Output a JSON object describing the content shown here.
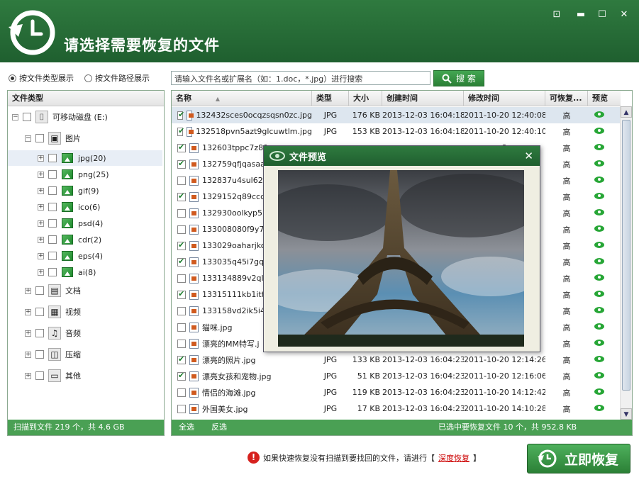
{
  "app": {
    "title": "请选择需要恢复的文件",
    "accent_color": "#2b7d3a",
    "window_buttons": [
      "minimize-to-tray",
      "minimize",
      "maximize",
      "close"
    ]
  },
  "view_mode": {
    "option1": "按文件类型展示",
    "option2": "按文件路径展示",
    "selected": "option1"
  },
  "search": {
    "value": "请输入文件名或扩展名（如：1.doc，*.jpg）进行搜索",
    "button": "搜 索"
  },
  "tree": {
    "header": "文件类型",
    "root": "可移动磁盘 (E:)",
    "pictures": "图片",
    "sub": [
      {
        "label": "jpg(20)",
        "selected": true
      },
      {
        "label": "png(25)"
      },
      {
        "label": "gif(9)"
      },
      {
        "label": "ico(6)"
      },
      {
        "label": "psd(4)"
      },
      {
        "label": "cdr(2)"
      },
      {
        "label": "eps(4)"
      },
      {
        "label": "ai(8)"
      }
    ],
    "others": [
      {
        "label": "文档",
        "icon": "document-icon"
      },
      {
        "label": "视频",
        "icon": "film-icon"
      },
      {
        "label": "音频",
        "icon": "music-icon"
      },
      {
        "label": "压缩",
        "icon": "archive-icon"
      },
      {
        "label": "其他",
        "icon": "window-icon"
      }
    ],
    "footer": "扫描到文件 219 个，共 4.6 GB"
  },
  "table": {
    "columns": {
      "name": "名称",
      "type": "类型",
      "size": "大小",
      "created": "创建时间",
      "modified": "修改时间",
      "recoverable": "可恢复...",
      "preview": "预览"
    },
    "rows": [
      {
        "name": "132432sces0ocqzsqsn0zc.jpg",
        "type": "JPG",
        "size": "176 KB",
        "created": "2013-12-03 16:04:18",
        "modified": "2011-10-20 12:40:08",
        "rec": "高",
        "checked": true,
        "selected": true
      },
      {
        "name": "132518pvn5azt9glcuwtlm.jpg",
        "type": "JPG",
        "size": "153 KB",
        "created": "2013-12-03 16:04:18",
        "modified": "2011-10-20 12:40:10",
        "rec": "高",
        "checked": true
      },
      {
        "name": "132603tppc7z89z",
        "type": "",
        "size": "",
        "created": "",
        "modified": "2",
        "rec": "高",
        "checked": true
      },
      {
        "name": "132759qfjqasaa7",
        "type": "",
        "size": "",
        "created": "",
        "modified": "",
        "rec": "高",
        "checked": true
      },
      {
        "name": "132837u4sul62f8",
        "type": "",
        "size": "",
        "created": "",
        "modified": "",
        "rec": "高",
        "checked": false
      },
      {
        "name": "1329152q89ccq6",
        "type": "",
        "size": "",
        "created": "",
        "modified": "",
        "rec": "高",
        "checked": true
      },
      {
        "name": "132930oolkyp5hc",
        "type": "",
        "size": "",
        "created": "",
        "modified": "",
        "rec": "高",
        "checked": false
      },
      {
        "name": "133008080f9y7ih",
        "type": "",
        "size": "",
        "created": "",
        "modified": "",
        "rec": "高",
        "checked": false
      },
      {
        "name": "133029oaharjkoo",
        "type": "",
        "size": "",
        "created": "",
        "modified": "",
        "rec": "高",
        "checked": true
      },
      {
        "name": "133035q45i7gq8",
        "type": "",
        "size": "",
        "created": "",
        "modified": "",
        "rec": "高",
        "checked": true
      },
      {
        "name": "133134889v2ql9l3",
        "type": "",
        "size": "",
        "created": "",
        "modified": "",
        "rec": "高",
        "checked": false
      },
      {
        "name": "13315111kb1itt1l",
        "type": "",
        "size": "",
        "created": "",
        "modified": "",
        "rec": "高",
        "checked": true
      },
      {
        "name": "133158vd2ik5i4k",
        "type": "",
        "size": "",
        "created": "",
        "modified": "",
        "rec": "高",
        "checked": false
      },
      {
        "name": "猫咪.jpg",
        "type": "",
        "size": "",
        "created": "",
        "modified": "",
        "rec": "高",
        "checked": false
      },
      {
        "name": "漂亮的MM特写.j",
        "type": "",
        "size": "",
        "created": "",
        "modified": "",
        "rec": "高",
        "checked": false
      },
      {
        "name": "漂亮的照片.jpg",
        "type": "JPG",
        "size": "133 KB",
        "created": "2013-12-03 16:04:23",
        "modified": "2011-10-20 12:14:26",
        "rec": "高",
        "checked": true
      },
      {
        "name": "漂亮女孩和宠物.jpg",
        "type": "JPG",
        "size": "51 KB",
        "created": "2013-12-03 16:04:23",
        "modified": "2011-10-20 12:16:06",
        "rec": "高",
        "checked": true
      },
      {
        "name": "情侣的海滩.jpg",
        "type": "JPG",
        "size": "119 KB",
        "created": "2013-12-03 16:04:23",
        "modified": "2011-10-20 14:12:42",
        "rec": "高",
        "checked": false
      },
      {
        "name": "外国美女.jpg",
        "type": "JPG",
        "size": "17 KB",
        "created": "2013-12-03 16:04:23",
        "modified": "2011-10-20 14:10:28",
        "rec": "高",
        "checked": false
      }
    ],
    "footer": {
      "select_all": "全选",
      "invert": "反选",
      "status": "已选中要恢复文件 10 个，共 952.8 KB"
    }
  },
  "preview": {
    "title": "文件预览"
  },
  "bottom": {
    "hint_before": "如果快速恢复没有扫描到要找回的文件，请进行【",
    "deep_link": "深度恢复",
    "hint_after": "】",
    "recover_button": "立即恢复"
  }
}
